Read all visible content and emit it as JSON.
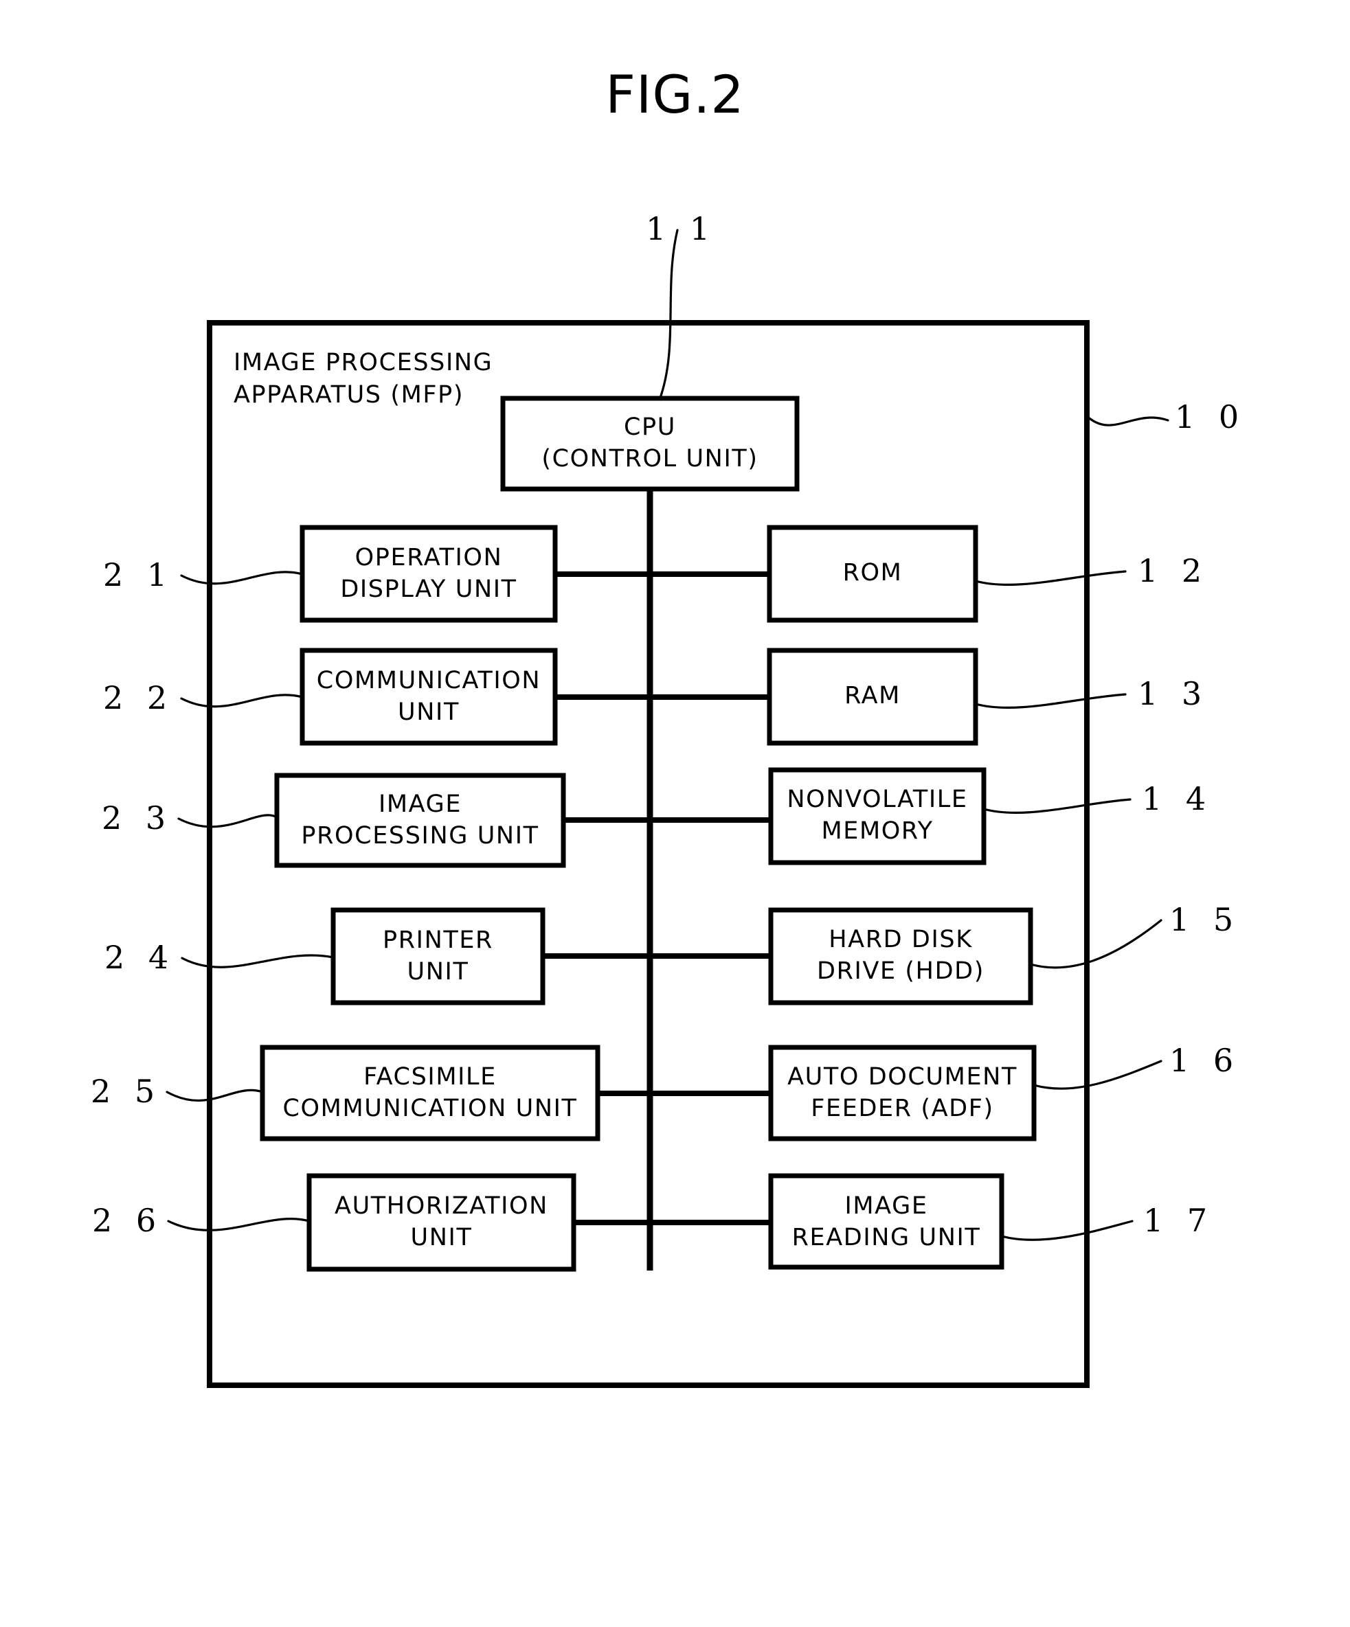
{
  "figure": {
    "title": "FIG.2",
    "apparatus_caption": "IMAGE PROCESSING\nAPPARATUS (MFP)"
  },
  "blocks": {
    "cpu": {
      "label": "CPU\n(CONTROL UNIT)",
      "ref": "1 1"
    },
    "operation_display_unit": {
      "label": "OPERATION\nDISPLAY UNIT",
      "ref": "2 1"
    },
    "communication_unit": {
      "label": "COMMUNICATION\nUNIT",
      "ref": "2 2"
    },
    "image_processing_unit": {
      "label": "IMAGE\nPROCESSING UNIT",
      "ref": "2 3"
    },
    "printer_unit": {
      "label": "PRINTER\nUNIT",
      "ref": "2 4"
    },
    "facsimile_communication_unit": {
      "label": "FACSIMILE\nCOMMUNICATION UNIT",
      "ref": "2 5"
    },
    "authorization_unit": {
      "label": "AUTHORIZATION\nUNIT",
      "ref": "2 6"
    },
    "rom": {
      "label": "ROM",
      "ref": "1 2"
    },
    "ram": {
      "label": "RAM",
      "ref": "1 3"
    },
    "nonvolatile_memory": {
      "label": "NONVOLATILE\nMEMORY",
      "ref": "1 4"
    },
    "hard_disk_drive": {
      "label": "HARD DISK\nDRIVE (HDD)",
      "ref": "1 5"
    },
    "auto_document_feeder": {
      "label": "AUTO DOCUMENT\nFEEDER (ADF)",
      "ref": "1 6"
    },
    "image_reading_unit": {
      "label": "IMAGE\nREADING UNIT",
      "ref": "1 7"
    }
  },
  "apparatus_ref": "1 0",
  "colors": {
    "ink": "#000000",
    "paper": "#ffffff"
  }
}
